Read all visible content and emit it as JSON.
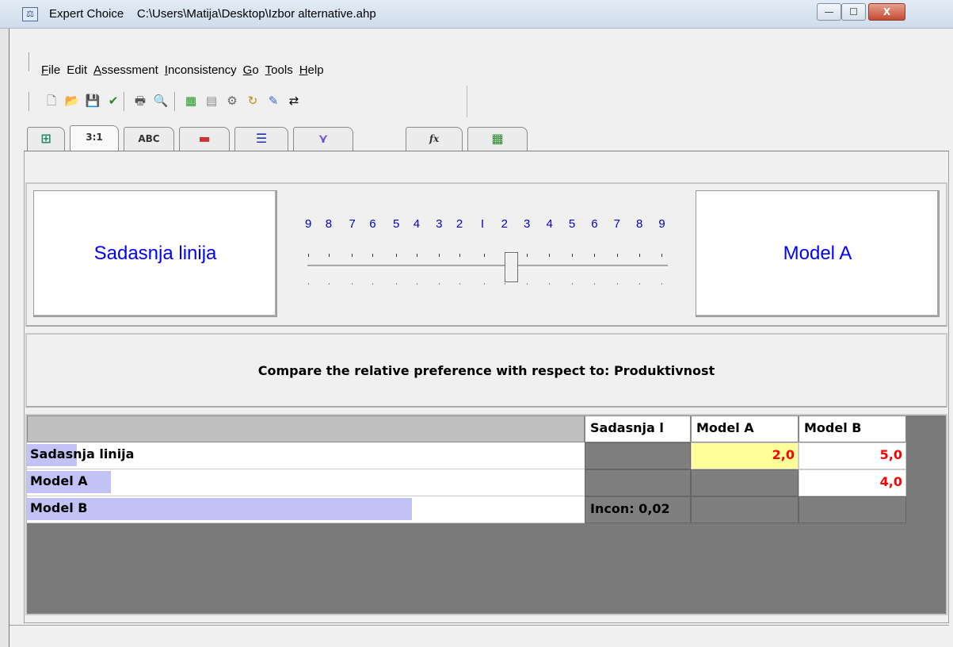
{
  "window": {
    "app_name": "Expert Choice",
    "file_path": "C:\\Users\\Matija\\Desktop\\Izbor alternative.ahp",
    "minimize": "—",
    "maximize": "☐",
    "close": "X"
  },
  "menu": {
    "items": [
      {
        "hot": "F",
        "rest": "ile"
      },
      {
        "hot": "",
        "rest": "Edit"
      },
      {
        "hot": "A",
        "rest": "ssessment"
      },
      {
        "hot": "I",
        "rest": "nconsistency"
      },
      {
        "hot": "G",
        "rest": "o"
      },
      {
        "hot": "T",
        "rest": "ools"
      },
      {
        "hot": "H",
        "rest": "elp"
      }
    ]
  },
  "toolbar": {
    "icons": [
      "new-file-icon",
      "open-folder-icon",
      "save-icon",
      "checkmark-icon",
      "print-icon",
      "print-preview-icon",
      "calculator-icon",
      "chart-icon",
      "gear-icon",
      "refresh-icon",
      "pencil-icon",
      "arrows-icon"
    ]
  },
  "tabs": [
    {
      "label": "",
      "icon": "tree-icon"
    },
    {
      "label": "3:1",
      "icon": ""
    },
    {
      "label": "ABC",
      "icon": ""
    },
    {
      "label": "",
      "icon": "bar-red-icon"
    },
    {
      "label": "",
      "icon": "bar-blue-icon"
    },
    {
      "label": "",
      "icon": "hierarchy-icon"
    },
    {
      "label": "fx",
      "icon": ""
    },
    {
      "label": "",
      "icon": "grid-icon"
    }
  ],
  "comparison": {
    "left_alternative": "Sadasnja linija",
    "right_alternative": "Model A",
    "scale_labels": [
      "9",
      "8",
      "7",
      "6",
      "5",
      "4",
      "3",
      "2",
      "I",
      "2",
      "3",
      "4",
      "5",
      "6",
      "7",
      "8",
      "9"
    ],
    "slider_value": 0.57
  },
  "prompt": "Compare the relative preference with respect to: Produktivnost",
  "matrix": {
    "columns": [
      "Sadasnja l",
      "Model A",
      "Model B"
    ],
    "rows": [
      {
        "name": "Sadasnja linija",
        "bar": 0.09,
        "cells": [
          "",
          "2,0",
          "5,0"
        ]
      },
      {
        "name": "Model A",
        "bar": 0.15,
        "cells": [
          "",
          "",
          "4,0"
        ]
      },
      {
        "name": "Model B",
        "bar": 0.69,
        "cells": [
          "Incon: 0,02",
          "",
          ""
        ]
      }
    ],
    "colors": {
      "value": "#ff0000",
      "selected": "#ffff99",
      "bar": "#c2c2f6",
      "empty": "#7f7f7f"
    }
  }
}
